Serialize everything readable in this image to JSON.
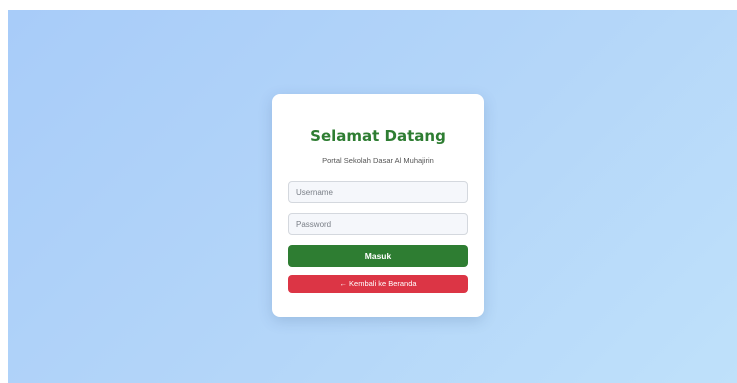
{
  "login": {
    "title": "Selamat Datang",
    "subtitle": "Portal Sekolah Dasar Al Muhajirin",
    "username": {
      "value": "",
      "placeholder": "Username"
    },
    "password": {
      "value": "",
      "placeholder": "Password"
    },
    "submit_label": "Masuk",
    "back_label": "← Kembali ke Beranda"
  },
  "colors": {
    "brand_green": "#2e7d32",
    "danger_red": "#dc3545",
    "background_gradient_start": "#a8ccf9",
    "background_gradient_end": "#bfe1fa"
  }
}
